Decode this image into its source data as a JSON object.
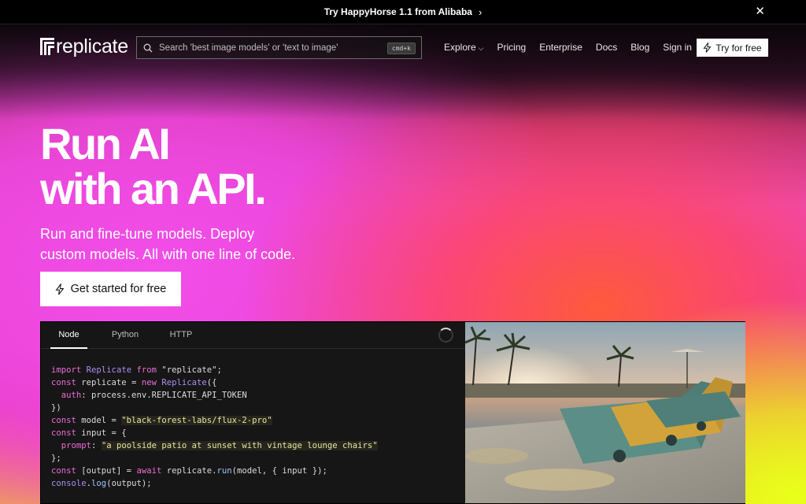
{
  "announcement": {
    "text": "Try HappyHorse 1.1 from Alibaba",
    "close": "✕"
  },
  "brand": {
    "name": "replicate"
  },
  "search": {
    "placeholder": "Search 'best image models' or 'text to image'",
    "shortcut": "cmd+k"
  },
  "nav": {
    "links": [
      "Explore",
      "Pricing",
      "Enterprise",
      "Docs",
      "Blog",
      "Sign in"
    ],
    "try_label": "Try for free"
  },
  "hero": {
    "line1": "Run AI",
    "line2": "with an API.",
    "sub1": "Run and fine-tune models. Deploy",
    "sub2": "custom models. All with one line of code.",
    "cta": "Get started for free"
  },
  "code_panel": {
    "tabs": [
      "Node",
      "Python",
      "HTTP"
    ],
    "active_tab": "Node",
    "lines": [
      "import Replicate from \"replicate\";",
      "const replicate = new Replicate({",
      "  auth: process.env.REPLICATE_API_TOKEN",
      "})",
      "const model = \"black-forest-labs/flux-2-pro\"",
      "const input = {",
      "  prompt: \"a poolside patio at sunset with vintage lounge chairs\"",
      "};",
      "const [output] = await replicate.run(model, { input });",
      "console.log(output);"
    ],
    "model": "\"black-forest-labs/flux-2-pro\"",
    "prompt": "\"a poolside patio at sunset with vintage lounge chairs\""
  },
  "colors": {
    "accent": "#f24ee9",
    "warm": "#ff5a3c",
    "yellow": "#e9ff1a",
    "panel": "#161616"
  }
}
